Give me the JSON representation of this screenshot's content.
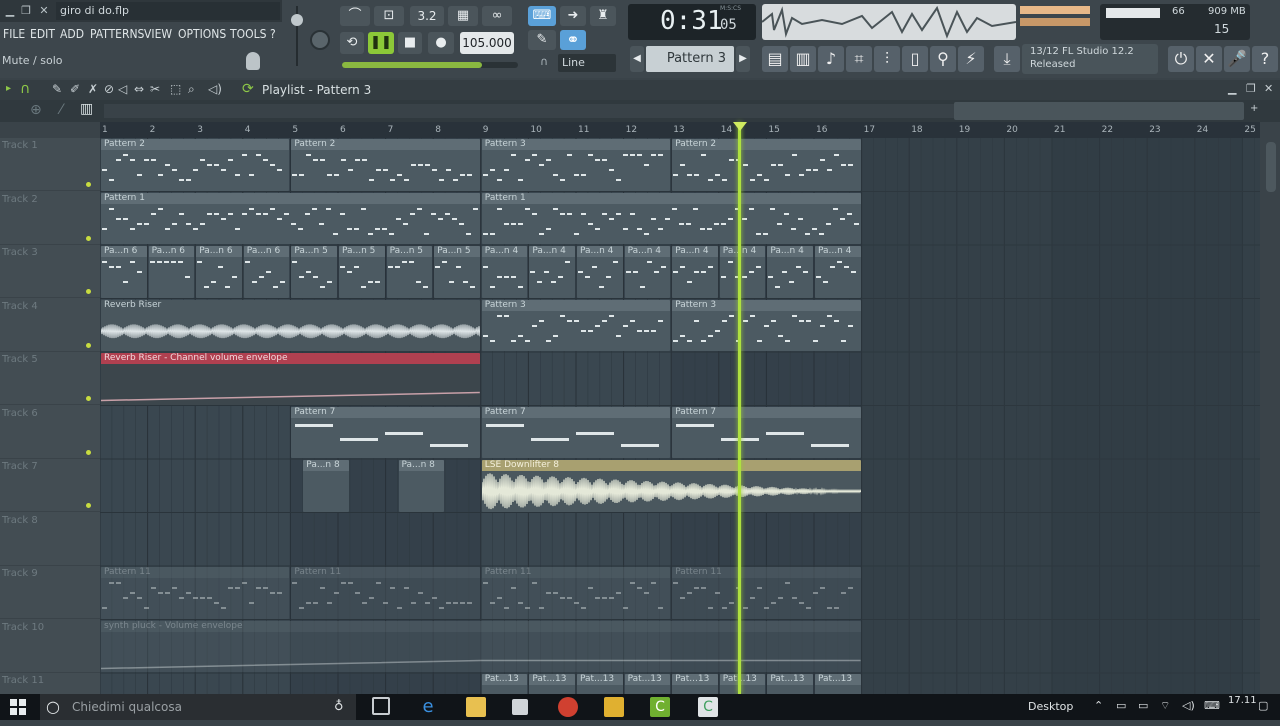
{
  "window": {
    "filename": "giro di do.flp",
    "hint": "Mute / solo"
  },
  "menu": [
    "FILE",
    "EDIT",
    "ADD",
    "PATTERNS",
    "VIEW",
    "OPTIONS",
    "TOOLS",
    "?"
  ],
  "transport": {
    "time_main": "0:31",
    "time_sub": "05",
    "time_unit": "M:S:CS",
    "tempo": "105.000",
    "snap_mode": "Line",
    "pattern": "Pattern 3",
    "time_sig": "3.2"
  },
  "meters": {
    "cpu": "66",
    "ram": "909 MB",
    "poly": "15"
  },
  "hint_panel": {
    "line1": "13/12  FL Studio 12.2",
    "line2": "Released"
  },
  "playlist": {
    "title": "Playlist - Pattern 3",
    "ruler": [
      "1",
      "2",
      "3",
      "4",
      "5",
      "6",
      "7",
      "8",
      "9",
      "10",
      "11",
      "12",
      "13",
      "14",
      "15",
      "16",
      "17",
      "18",
      "19",
      "20",
      "21",
      "22",
      "23",
      "24",
      "25"
    ],
    "tracks": [
      "Track 1",
      "Track 2",
      "Track 3",
      "Track 4",
      "Track 5",
      "Track 6",
      "Track 7",
      "Track 8",
      "Track 9",
      "Track 10",
      "Track 11"
    ],
    "clips": {
      "p2": "Pattern 2",
      "p1": "Pattern 1",
      "p3": "Pattern 3",
      "p7": "Pattern 7",
      "p6": "Pa...n 6",
      "p5": "Pa...n 5",
      "p4": "Pa...n 4",
      "p8": "Pa...n 8",
      "p11": "Pattern 11",
      "p13": "Pat...13",
      "riser": "Reverb Riser",
      "riser_env": "Reverb Riser - Channel volume envelope",
      "downlifter": "LSE Downlifter 8",
      "synth_env": "synth pluck - Volume envelope"
    }
  },
  "taskbar": {
    "search_placeholder": "Chiedimi qualcosa",
    "desktop": "Desktop",
    "time": "17.11"
  },
  "colors": {
    "playhead": "#aee040",
    "lcd_bg": "#1d2428",
    "accent_blue": "#5aa0d8",
    "envelope_red": "#b04050"
  }
}
